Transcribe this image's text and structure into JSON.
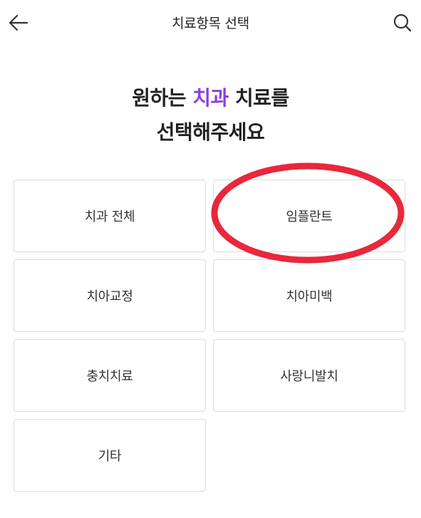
{
  "header": {
    "title": "치료항목 선택",
    "back_icon": "arrow-left-icon",
    "search_icon": "search-icon"
  },
  "headline": {
    "line1_pre": "원하는 ",
    "line1_accent": "치과",
    "line1_post": " 치료를",
    "line2": "선택해주세요",
    "accent_color": "#8a3fe0"
  },
  "options": [
    {
      "label": "치과 전체"
    },
    {
      "label": "임플란트"
    },
    {
      "label": "치아교정"
    },
    {
      "label": "치아미백"
    },
    {
      "label": "충치치료"
    },
    {
      "label": "사랑니발치"
    },
    {
      "label": "기타"
    }
  ],
  "annotation": {
    "color": "#e8283c",
    "target": "임플란트"
  }
}
